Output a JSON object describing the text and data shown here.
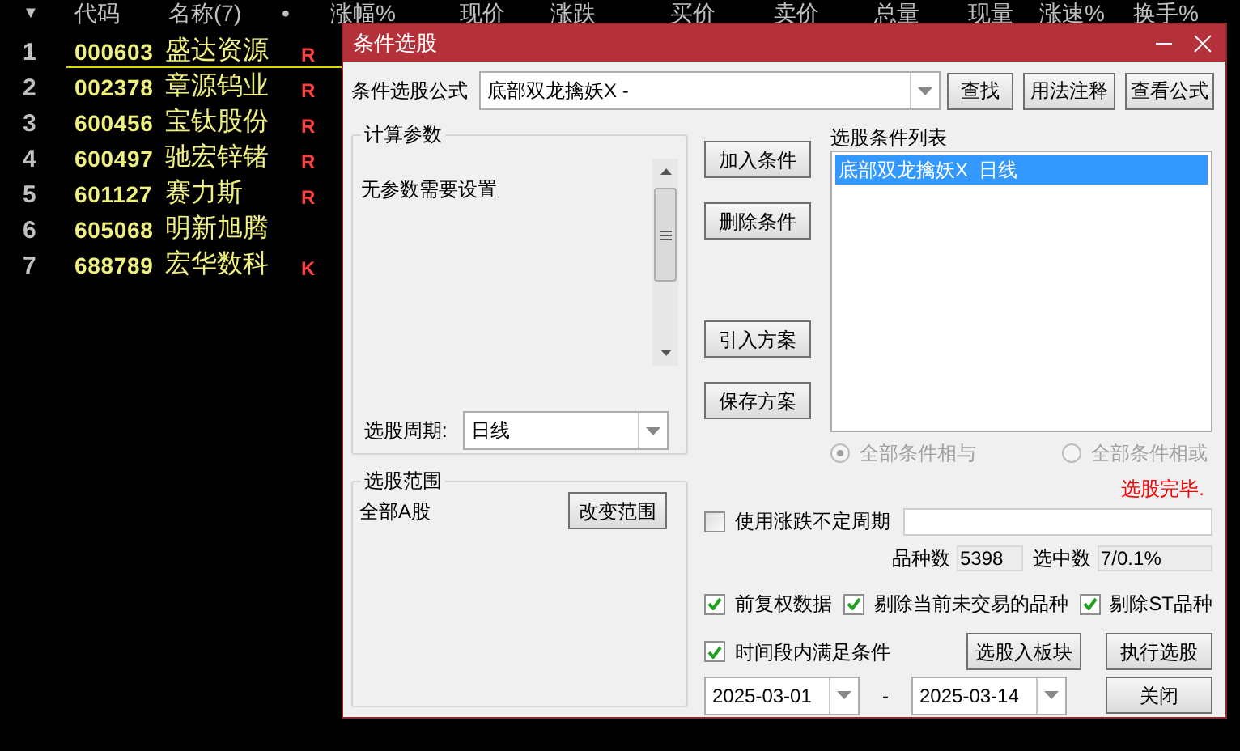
{
  "stock_table": {
    "header": [
      "▼",
      "代码",
      "名称(7)",
      "•",
      "涨幅%",
      "现价",
      "涨跌",
      "买价",
      "卖价",
      "总量",
      "现量",
      "涨速%",
      "换手%"
    ],
    "rows": [
      {
        "index": "1",
        "code": "000603",
        "name": "盛达资源",
        "flag": "R",
        "selected": true
      },
      {
        "index": "2",
        "code": "002378",
        "name": "章源钨业",
        "flag": "R",
        "selected": false
      },
      {
        "index": "3",
        "code": "600456",
        "name": "宝钛股份",
        "flag": "R",
        "selected": false
      },
      {
        "index": "4",
        "code": "600497",
        "name": "驰宏锌锗",
        "flag": "R",
        "selected": false
      },
      {
        "index": "5",
        "code": "601127",
        "name": "赛力斯",
        "flag": "R",
        "selected": false
      },
      {
        "index": "6",
        "code": "605068",
        "name": "明新旭腾",
        "selected": false
      },
      {
        "index": "7",
        "code": "688789",
        "name": "宏华数科",
        "flag": "K",
        "selected": false
      }
    ]
  },
  "dialog": {
    "title": "条件选股",
    "formula": {
      "label": "条件选股公式",
      "value": "底部双龙擒妖X -"
    },
    "top_buttons": [
      "查找",
      "用法注释",
      "查看公式"
    ],
    "params_group": {
      "title": "计算参数",
      "message": "无参数需要设置",
      "period_label": "选股周期:",
      "period_value": "日线"
    },
    "action_buttons": [
      "加入条件",
      "删除条件",
      "引入方案",
      "保存方案"
    ],
    "condition_list": {
      "title": "选股条件列表",
      "items": [
        {
          "text": "底部双龙擒妖X  日线",
          "selected": true
        }
      ]
    },
    "logic_options": [
      {
        "label": "全部条件相与",
        "selected": true,
        "disabled": true
      },
      {
        "label": "全部条件相或",
        "selected": false,
        "disabled": true
      }
    ],
    "status": "选股完毕.",
    "range_group": {
      "title": "选股范围",
      "value": "全部A股",
      "button": "改变范围"
    },
    "variable_period": {
      "label": "使用涨跌不定周期",
      "checked": false
    },
    "stats": [
      {
        "label": "品种数",
        "value": "5398"
      },
      {
        "label": "选中数",
        "value": "7/0.1%"
      }
    ],
    "options": [
      {
        "label": "前复权数据",
        "checked": true
      },
      {
        "label": "剔除当前未交易的品种",
        "checked": true
      },
      {
        "label": "剔除ST品种",
        "checked": true
      }
    ],
    "time_range": {
      "label": "时间段内满足条件",
      "checked": true
    },
    "bottom_buttons": [
      "选股入板块",
      "执行选股"
    ],
    "date_from": "2025-03-01",
    "separator": "-",
    "date_to": "2025-03-14",
    "close_button": "关闭"
  }
}
